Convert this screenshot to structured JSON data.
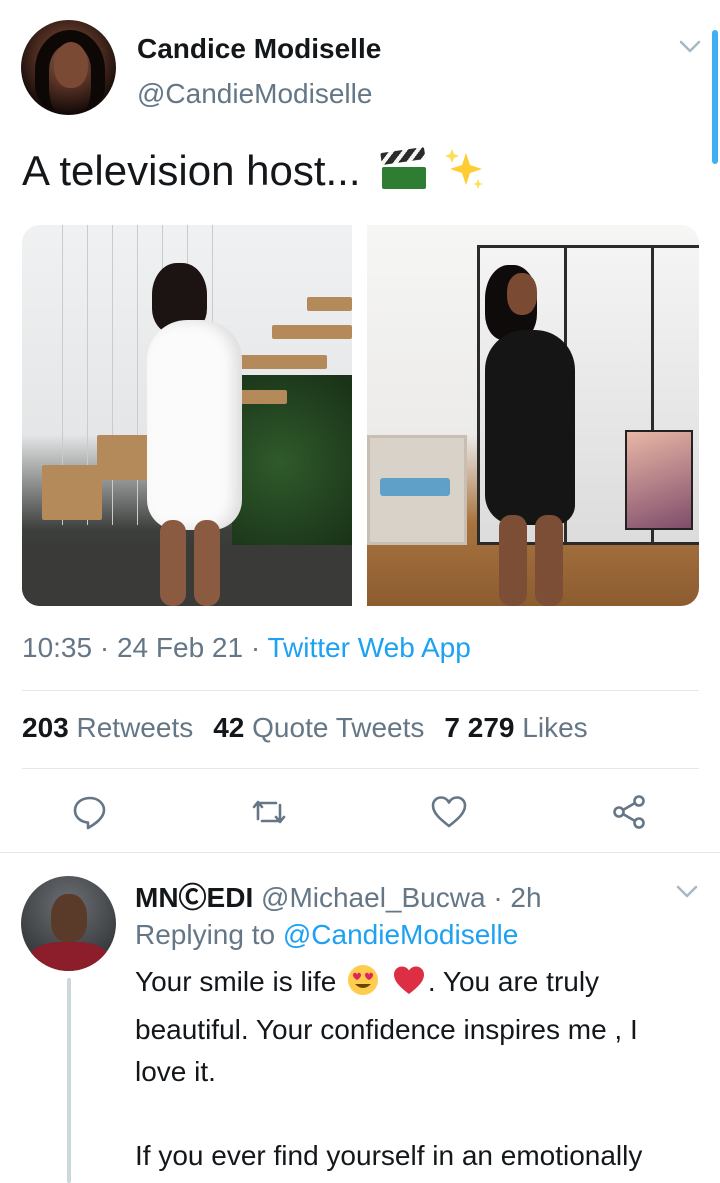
{
  "tweet": {
    "author_name": "Candice Modiselle",
    "author_handle": "@CandieModiselle",
    "text": "A television host...",
    "emojis": [
      "clapper-board-icon",
      "sparkles-icon"
    ],
    "time": "10:35",
    "date": "24 Feb 21",
    "separator": " · ",
    "source": "Twitter Web App",
    "stats": {
      "retweets_count": "203",
      "retweets_label": "Retweets",
      "quotes_count": "42",
      "quotes_label": "Quote Tweets",
      "likes_count": "7 279",
      "likes_label": "Likes"
    },
    "actions": [
      "reply-icon",
      "retweet-icon",
      "like-icon",
      "share-icon"
    ]
  },
  "reply": {
    "author_name": "MNⒸEDI",
    "author_handle": "@Michael_Bucwa",
    "time": "· 2h",
    "replying_prefix": "Replying to",
    "replying_mention": "@CandieModiselle",
    "text_part1": "Your smile is life",
    "text_part2": ".  You are truly beautiful. Your confidence inspires me , I love it.",
    "text_para2": "If you ever find yourself in an emotionally stressful situation, just know that I am"
  },
  "colors": {
    "accent": "#1da1f2",
    "secondary_text": "#657786",
    "divider": "#e1e8ed"
  }
}
